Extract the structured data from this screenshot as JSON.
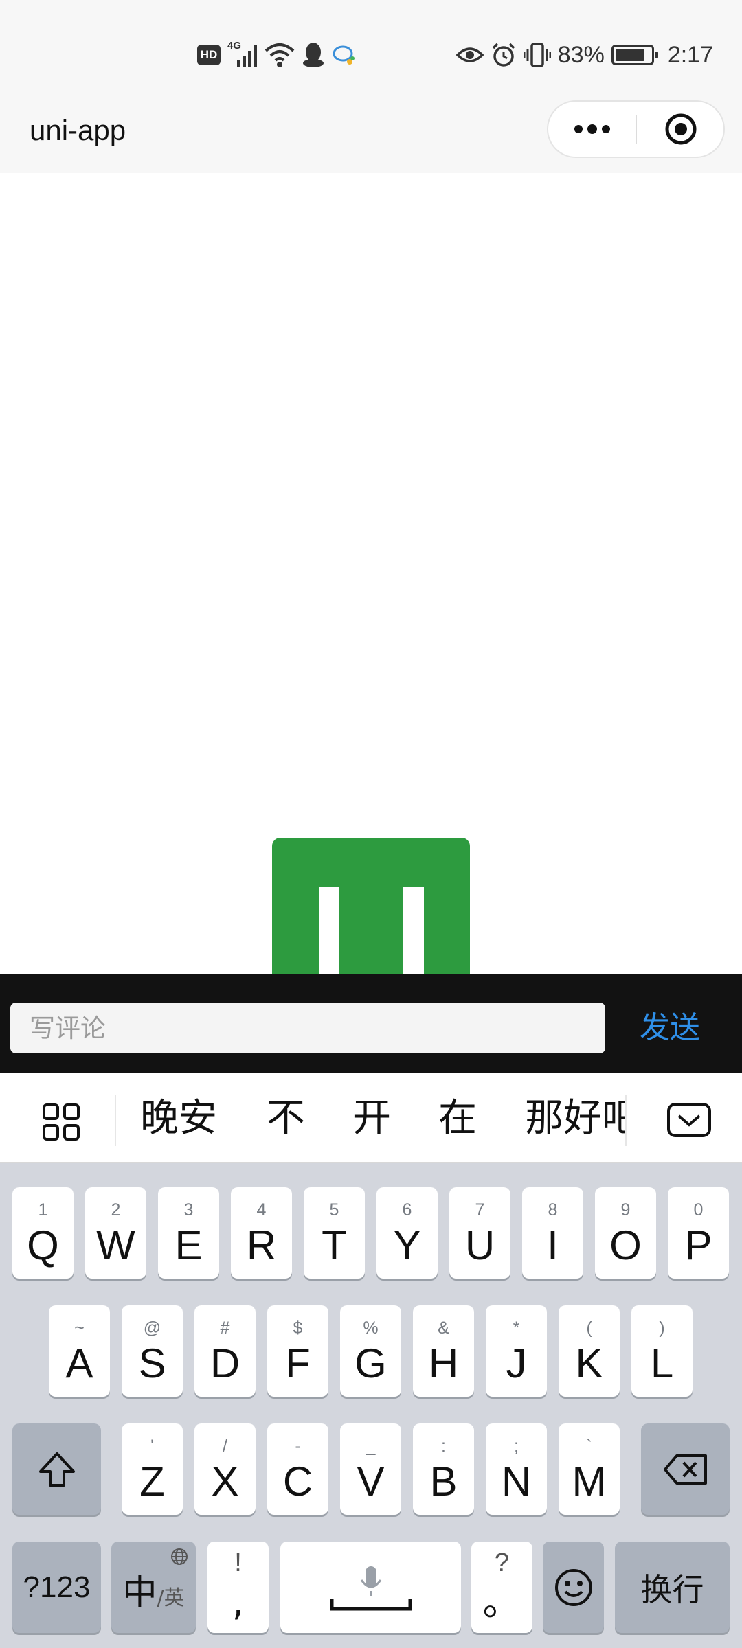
{
  "status_bar": {
    "left_icons": [
      "hd-badge",
      "4g-signal-icon",
      "wifi-icon",
      "qq-icon",
      "message-icon"
    ],
    "hd_label": "HD",
    "network_label": "4G",
    "right_icons": [
      "eye-icon",
      "alarm-icon",
      "vibrate-icon",
      "battery-icon"
    ],
    "battery_percent_text": "83%",
    "battery_level": 0.83,
    "time": "2:17"
  },
  "nav_bar": {
    "title": "uni-app",
    "more_icon": "more-dots-icon",
    "close_icon": "target-close-icon"
  },
  "content": {
    "logo_icon": "app-logo",
    "logo_color": "#2d9b3f"
  },
  "comment_bar": {
    "placeholder": "写评论",
    "value": "",
    "send_label": "发送",
    "send_color": "#2f8fe8"
  },
  "keyboard": {
    "candidates": [
      "晚安",
      "不",
      "开",
      "在",
      "那好吧"
    ],
    "menu_icon": "grid-menu-icon",
    "collapse_icon": "chevron-down-icon",
    "row1": [
      {
        "letter": "Q",
        "hint": "1"
      },
      {
        "letter": "W",
        "hint": "2"
      },
      {
        "letter": "E",
        "hint": "3"
      },
      {
        "letter": "R",
        "hint": "4"
      },
      {
        "letter": "T",
        "hint": "5"
      },
      {
        "letter": "Y",
        "hint": "6"
      },
      {
        "letter": "U",
        "hint": "7"
      },
      {
        "letter": "I",
        "hint": "8"
      },
      {
        "letter": "O",
        "hint": "9"
      },
      {
        "letter": "P",
        "hint": "0"
      }
    ],
    "row2": [
      {
        "letter": "A",
        "hint": "~"
      },
      {
        "letter": "S",
        "hint": "@"
      },
      {
        "letter": "D",
        "hint": "#"
      },
      {
        "letter": "F",
        "hint": "$"
      },
      {
        "letter": "G",
        "hint": "%"
      },
      {
        "letter": "H",
        "hint": "&"
      },
      {
        "letter": "J",
        "hint": "*"
      },
      {
        "letter": "K",
        "hint": "("
      },
      {
        "letter": "L",
        "hint": ")"
      }
    ],
    "row3": [
      {
        "letter": "Z",
        "hint": "'"
      },
      {
        "letter": "X",
        "hint": "/"
      },
      {
        "letter": "C",
        "hint": "-"
      },
      {
        "letter": "V",
        "hint": "_"
      },
      {
        "letter": "B",
        "hint": ":"
      },
      {
        "letter": "N",
        "hint": ";"
      },
      {
        "letter": "M",
        "hint": "`"
      }
    ],
    "shift_icon": "shift-icon",
    "backspace_icon": "backspace-icon",
    "symbols_label": "?123",
    "lang_main": "中",
    "lang_sub": "/英",
    "globe_icon": "globe-icon",
    "comma_hint": "!",
    "comma_label": ",",
    "mic_icon": "microphone-icon",
    "period_hint": "?",
    "period_label": "。",
    "emoji_icon": "emoji-icon",
    "enter_label": "换行"
  }
}
